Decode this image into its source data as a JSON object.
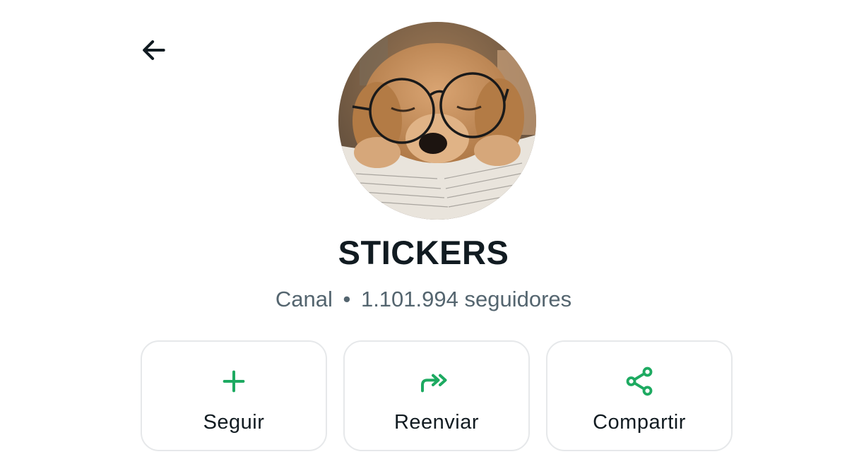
{
  "header": {
    "back_icon": "arrow-left-icon"
  },
  "channel": {
    "name": "STICKERS",
    "type_label": "Canal",
    "separator": "•",
    "followers_text": "1.101.994 seguidores",
    "avatar_description": "puppy-with-glasses-avatar"
  },
  "actions": [
    {
      "label": "Seguir",
      "icon": "plus-icon"
    },
    {
      "label": "Reenviar",
      "icon": "forward-icon"
    },
    {
      "label": "Compartir",
      "icon": "share-icon"
    }
  ],
  "colors": {
    "accent": "#1daa61",
    "title": "#111b21",
    "subtitle": "#54656f",
    "border": "#e6e8ea"
  }
}
